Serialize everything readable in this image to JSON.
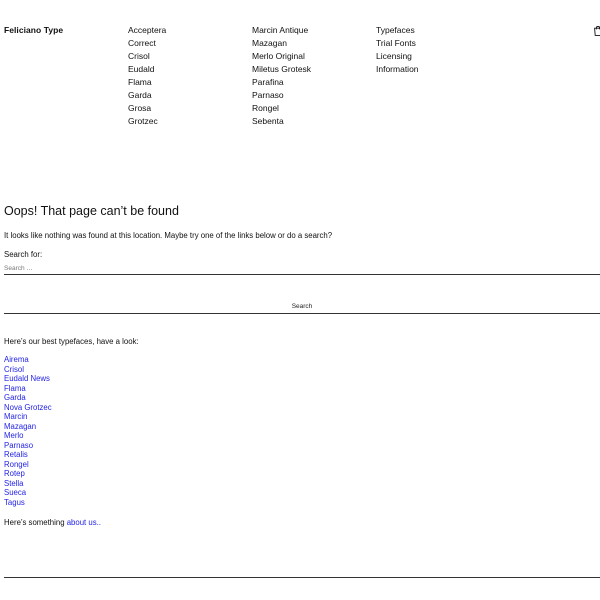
{
  "header": {
    "brand": "Feliciano Type",
    "nav_columns": [
      [
        "Acceptera",
        "Correct",
        "Crisol",
        "Eudald",
        "Flama",
        "Garda",
        "Grosa",
        "Grotzec"
      ],
      [
        "Marcin Antique",
        "Mazagan",
        "Merlo Original",
        "Miletus Grotesk",
        "Parafina",
        "Parnaso",
        "Rongel",
        "Sebenta"
      ],
      [
        "Typefaces",
        "Trial Fonts",
        "Licensing",
        "Information"
      ]
    ],
    "cart_icon": "bag-icon"
  },
  "main": {
    "title": "Oops! That page can’t be found",
    "intro": "It looks like nothing was found at this location. Maybe try one of the links below or do a search?",
    "search": {
      "label": "Search for:",
      "placeholder": "Search …",
      "value": "",
      "button_label": "Search"
    },
    "best_intro": "Here’s our best typefaces, have a look:",
    "typefaces": [
      "Airema",
      "Crisol",
      "Eudald News",
      "Flama",
      "Garda",
      "Nova Grotzec",
      "Marcin",
      "Mazagan",
      "Merlo",
      "Parnaso",
      "Retalis",
      "Rongel",
      "Rotep",
      "Stella",
      "Sueca",
      "Tagus"
    ],
    "about_prefix": "Here’s something ",
    "about_link": "about us.."
  },
  "colors": {
    "link": "#2323e6",
    "text": "#111111",
    "rule": "#333333",
    "background": "#ffffff"
  }
}
